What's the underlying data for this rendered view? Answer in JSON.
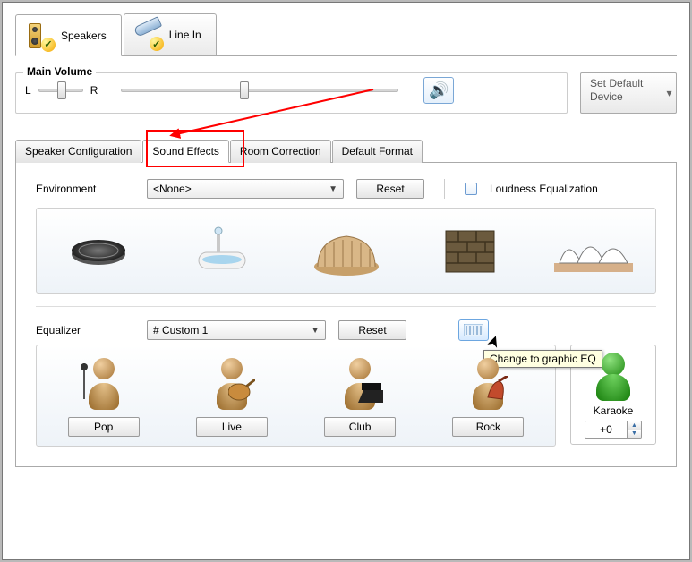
{
  "topTabs": {
    "speakers": "Speakers",
    "lineIn": "Line In"
  },
  "volume": {
    "legend": "Main Volume",
    "leftLabel": "L",
    "rightLabel": "R"
  },
  "defaultDevice": {
    "label": "Set Default Device"
  },
  "subTabs": {
    "speakerConfig": "Speaker Configuration",
    "soundEffects": "Sound Effects",
    "roomCorrection": "Room Correction",
    "defaultFormat": "Default Format"
  },
  "environment": {
    "label": "Environment",
    "selected": "<None>",
    "reset": "Reset",
    "loudness": "Loudness Equalization"
  },
  "equalizer": {
    "label": "Equalizer",
    "selected": "# Custom 1",
    "reset": "Reset",
    "tooltip": "Change to graphic EQ",
    "presets": [
      "Pop",
      "Live",
      "Club",
      "Rock"
    ],
    "karaokeLabel": "Karaoke",
    "karaokeValue": "+0"
  }
}
